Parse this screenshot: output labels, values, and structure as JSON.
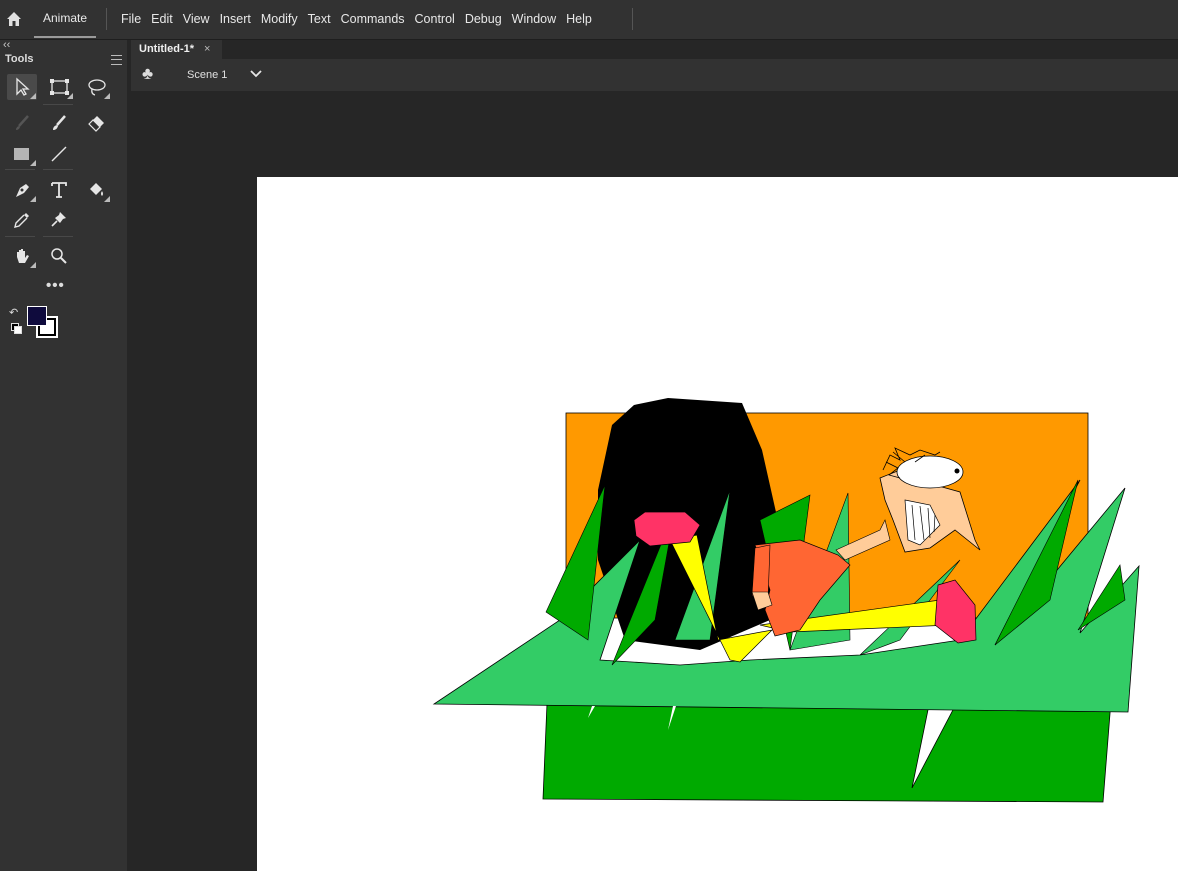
{
  "header": {
    "home_icon": "home-icon",
    "app_tab": "Animate",
    "menus": [
      "File",
      "Edit",
      "View",
      "Insert",
      "Modify",
      "Text",
      "Commands",
      "Control",
      "Debug",
      "Window",
      "Help"
    ]
  },
  "tools_panel": {
    "collapse": "‹‹",
    "title": "Tools",
    "tools": [
      "selection-tool",
      "free-transform-tool",
      "lasso-tool",
      "paint-brush-tool",
      "brush-tool",
      "eraser-tool",
      "rectangle-tool",
      "line-tool",
      "pen-tool",
      "text-tool",
      "paint-bucket-tool",
      "eyedropper-tool",
      "pin-tool",
      "hand-tool",
      "zoom-tool"
    ],
    "more": "•••",
    "fill_color": "#0f0b3d",
    "stroke_color": "#ffffff"
  },
  "document": {
    "tab_title": "Untitled-1*",
    "close": "×",
    "scene_label": "Scene 1"
  },
  "colors": {
    "chrome": "#323232",
    "pasteboard": "#262626",
    "stage": "#ffffff",
    "orange": "#ff9900",
    "grass_light": "#33cc66",
    "grass_dark": "#00aa00",
    "pink": "#ff3366",
    "yellow": "#ffff00",
    "skin": "#ffcc99"
  }
}
